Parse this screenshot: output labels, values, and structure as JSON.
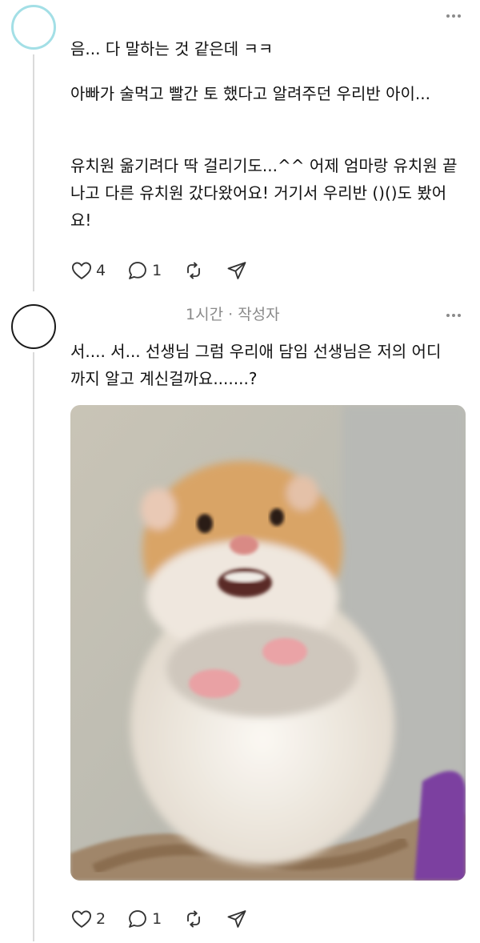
{
  "comment1": {
    "paragraphs": [
      "음... 다 말하는 것 같은데 ㅋㅋ",
      "아빠가 술먹고 빨간 토 했다고 알려주던 우리반 아이...",
      "유치원 옮기려다 딱 걸리기도...^^ 어제 엄마랑 유치원 끝나고 다른 유치원 갔다왔어요! 거기서 우리반 ()()도 봤어요!"
    ],
    "like_count": "4",
    "reply_count": "1",
    "avatar_border": "#a3dfe6"
  },
  "comment2": {
    "time": "1시간",
    "separator": "·",
    "author_tag": "작성자",
    "text": "서.... 서... 선생님 그럼 우리애 담임 선생님은 저의 어디까지 알고 계신걸까요.......?",
    "like_count": "2",
    "reply_count": "1",
    "image_subject": "hamster-photo"
  },
  "icons": {
    "like": "heart-icon",
    "reply": "comment-icon",
    "repost": "repost-icon",
    "share": "send-icon",
    "more": "more-dots-icon"
  }
}
